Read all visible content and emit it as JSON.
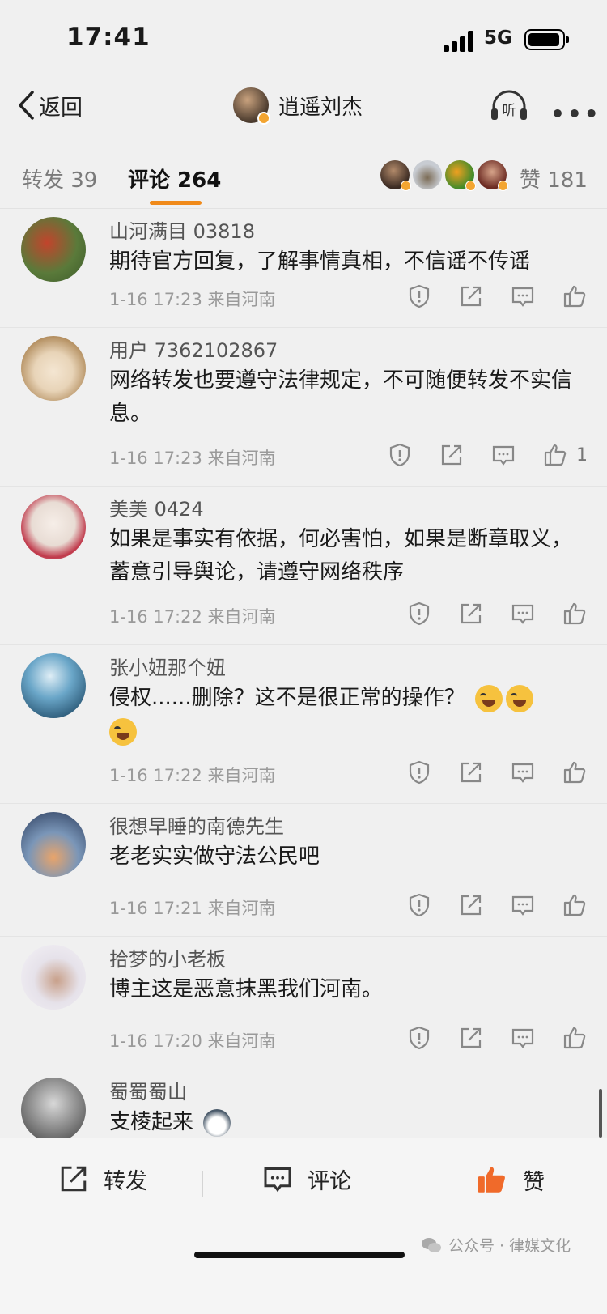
{
  "status": {
    "time": "17:41",
    "network": "5G"
  },
  "nav": {
    "back_label": "返回",
    "user_name": "逍遥刘杰",
    "listen_label": "听",
    "more_label": "•••"
  },
  "tabs": {
    "repost_label": "转发 39",
    "comment_label": "评论 264",
    "like_label": "赞 181"
  },
  "comments": [
    {
      "user": "山河满目 03818",
      "text": "期待官方回复，了解事情真相，不信谣不传谣",
      "meta": "1-16 17:23  来自河南",
      "likes": ""
    },
    {
      "user": "用户 7362102867",
      "text": "网络转发也要遵守法律规定，不可随便转发不实信息。",
      "meta": "1-16 17:23  来自河南",
      "likes": "1"
    },
    {
      "user": "美美 0424",
      "text": "如果是事实有依据，何必害怕，如果是断章取义，蓄意引导舆论，请遵守网络秩序",
      "meta": "1-16 17:22  来自河南",
      "likes": ""
    },
    {
      "user": "张小妞那个妞",
      "text": "侵权......删除？这不是很正常的操作？",
      "meta": "1-16 17:22  来自河南",
      "likes": "",
      "emoji": "laugh-cry"
    },
    {
      "user": "很想早睡的南德先生",
      "text": "老老实实做守法公民吧",
      "meta": "1-16 17:21  来自河南",
      "likes": ""
    },
    {
      "user": "拾梦的小老板",
      "text": "博主这是恶意抹黑我们河南。",
      "meta": "1-16 17:20  来自河南",
      "likes": ""
    },
    {
      "user": "蜀蜀蜀山",
      "text": "支棱起来",
      "meta": "",
      "likes": "",
      "emoji": "husky"
    }
  ],
  "bottom": {
    "repost_label": "转发",
    "comment_label": "评论",
    "like_label": "赞",
    "watermark": "公众号 · 律媒文化"
  },
  "colors": {
    "accent": "#f08a1a",
    "like_active": "#f06a2a"
  }
}
